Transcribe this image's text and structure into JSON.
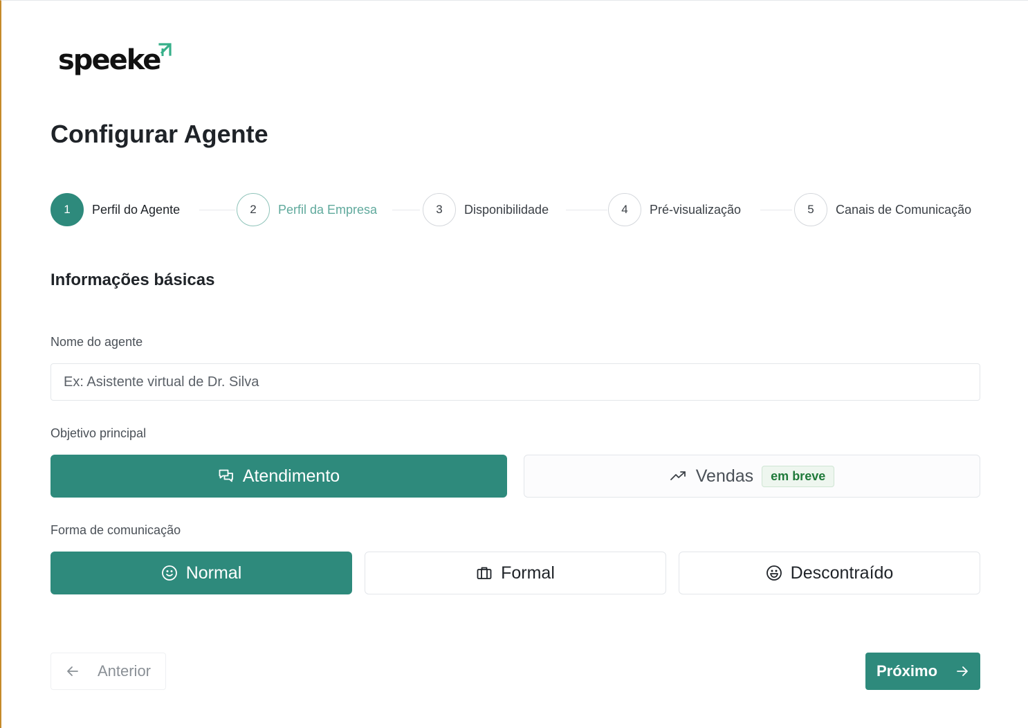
{
  "brand": {
    "name": "speeke",
    "accent": "#2e8a7c",
    "arrow_color": "#37b08a"
  },
  "page": {
    "title": "Configurar Agente"
  },
  "stepper": {
    "steps": [
      {
        "number": "1",
        "label": "Perfil do Agente",
        "state": "active"
      },
      {
        "number": "2",
        "label": "Perfil da Empresa",
        "state": "next"
      },
      {
        "number": "3",
        "label": "Disponibilidade",
        "state": "pending"
      },
      {
        "number": "4",
        "label": "Pré-visualização",
        "state": "pending"
      },
      {
        "number": "5",
        "label": "Canais de Comunicação",
        "state": "pending"
      }
    ]
  },
  "section": {
    "title": "Informações básicas"
  },
  "agent_name": {
    "label": "Nome do agente",
    "value": "",
    "placeholder": "Ex: Asistente virtual de Dr. Silva"
  },
  "objective": {
    "label": "Objetivo principal",
    "options": [
      {
        "label": "Atendimento",
        "icon": "chat-bubbles-icon",
        "selected": true
      },
      {
        "label": "Vendas",
        "icon": "trending-up-icon",
        "selected": false,
        "badge": "em breve"
      }
    ]
  },
  "communication": {
    "label": "Forma de comunicação",
    "options": [
      {
        "label": "Normal",
        "icon": "smile-icon",
        "selected": true
      },
      {
        "label": "Formal",
        "icon": "briefcase-icon",
        "selected": false
      },
      {
        "label": "Descontraído",
        "icon": "laugh-icon",
        "selected": false
      }
    ]
  },
  "navigation": {
    "prev_label": "Anterior",
    "next_label": "Próximo"
  }
}
